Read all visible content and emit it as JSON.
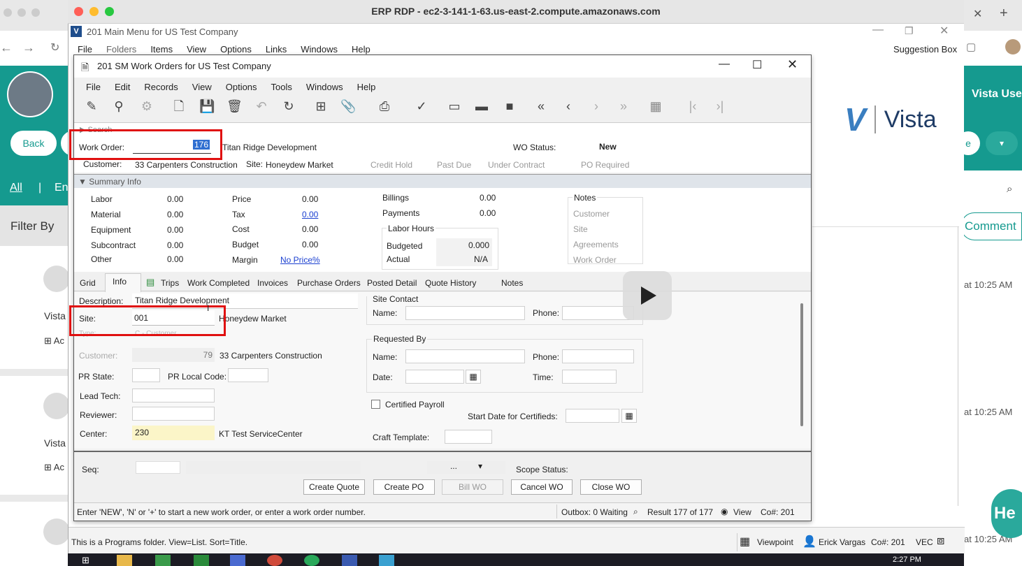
{
  "rdp": {
    "title": "ERP RDP - ec2-3-141-1-63.us-east-2.compute.amazonaws.com"
  },
  "main": {
    "title": "201 Main Menu for US Test Company",
    "menu": [
      "File",
      "Folders",
      "Items",
      "View",
      "Options",
      "Links",
      "Windows",
      "Help"
    ],
    "suggestion": "Suggestion Box"
  },
  "bg": {
    "back": "Back",
    "all": "All",
    "en": "En",
    "filter": "Filter By",
    "vista1": "Vista",
    "vista2": "Vista",
    "ac1": "Ac",
    "ac2": "Ac",
    "time1": "at 10:25 AM",
    "time2": "at 10:25 AM",
    "time3": "at 10:25 AM",
    "comment": "Comment",
    "vista_user": "Vista Use",
    "brand": "Vista",
    "help": "He",
    "e": "e"
  },
  "wo": {
    "title": "201 SM Work Orders for US Test Company",
    "menu": [
      "File",
      "Edit",
      "Records",
      "View",
      "Options",
      "Tools",
      "Windows",
      "Help"
    ],
    "search": "Search",
    "work_order_label": "Work Order:",
    "work_order": "176",
    "wo_name": "Titan Ridge Development",
    "wo_status_label": "WO Status:",
    "wo_status": "New",
    "customer_label": "Customer:",
    "customer": "33 Carpenters Construction",
    "site_label": "Site:",
    "site": "Honeydew Market",
    "flags": [
      "Credit Hold",
      "Past Due",
      "Under Contract",
      "PO Required"
    ],
    "summary": "Summary Info",
    "costs": [
      {
        "l": "Labor",
        "v": "0.00"
      },
      {
        "l": "Material",
        "v": "0.00"
      },
      {
        "l": "Equipment",
        "v": "0.00"
      },
      {
        "l": "Subcontract",
        "v": "0.00"
      },
      {
        "l": "Other",
        "v": "0.00"
      }
    ],
    "prices": [
      {
        "l": "Price",
        "v": "0.00"
      },
      {
        "l": "Tax",
        "v": "0.00"
      },
      {
        "l": "Cost",
        "v": "0.00"
      },
      {
        "l": "Budget",
        "v": "0.00"
      },
      {
        "l": "Margin",
        "v": "No Price%"
      }
    ],
    "billings_label": "Billings",
    "billings": "0.00",
    "payments_label": "Payments",
    "payments": "0.00",
    "labor_hours": "Labor Hours",
    "budgeted_label": "Budgeted",
    "budgeted": "0.000",
    "actual_label": "Actual",
    "actual": "N/A",
    "notes": {
      "title": "Notes",
      "items": [
        "Customer",
        "Site",
        "Agreements",
        "Work Order"
      ]
    },
    "tabs": [
      "Grid",
      "Info",
      "Trips",
      "Work Completed",
      "Invoices",
      "Purchase Orders",
      "Posted Detail",
      "Quote History",
      "Notes"
    ],
    "desc_label": "Description:",
    "desc": "Titan Ridge Development",
    "site2_label": "Site:",
    "site2": "001",
    "site2_name": "Honeydew Market",
    "type_label": "Type:",
    "type_val": "C - Customer",
    "cust2_label": "Customer:",
    "cust2_num": "79",
    "cust2_name": "33 Carpenters Construction",
    "pr_state": "PR State:",
    "pr_local": "PR Local Code:",
    "lead_tech": "Lead Tech:",
    "reviewer": "Reviewer:",
    "center_label": "Center:",
    "center": "230",
    "center_name": "KT Test ServiceCenter",
    "site_contact": "Site Contact",
    "name_label": "Name:",
    "phone_label": "Phone:",
    "requested_by": "Requested By",
    "date_label": "Date:",
    "time_label": "Time:",
    "certified": "Certified Payroll",
    "start_cert": "Start Date for Certifieds:",
    "craft": "Craft Template:",
    "seq": "Seq:",
    "ellipsis": "...",
    "scope_status": "Scope Status:",
    "buttons": [
      "Create Quote",
      "Create PO",
      "Bill WO",
      "Cancel WO",
      "Close WO"
    ],
    "status_msg": "Enter 'NEW', 'N' or '+' to start a new work order, or enter a work order number.",
    "outbox": "Outbox: 0 Waiting",
    "result": "Result 177 of 177",
    "view": "View",
    "co": "Co#: 201"
  },
  "footer": {
    "folder_msg": "This is a Programs folder. View=List. Sort=Title.",
    "viewpoint": "Viewpoint",
    "user": "Erick Vargas",
    "co": "Co#: 201",
    "vec": "VEC"
  },
  "taskbar": {
    "time": "2:27 PM"
  }
}
